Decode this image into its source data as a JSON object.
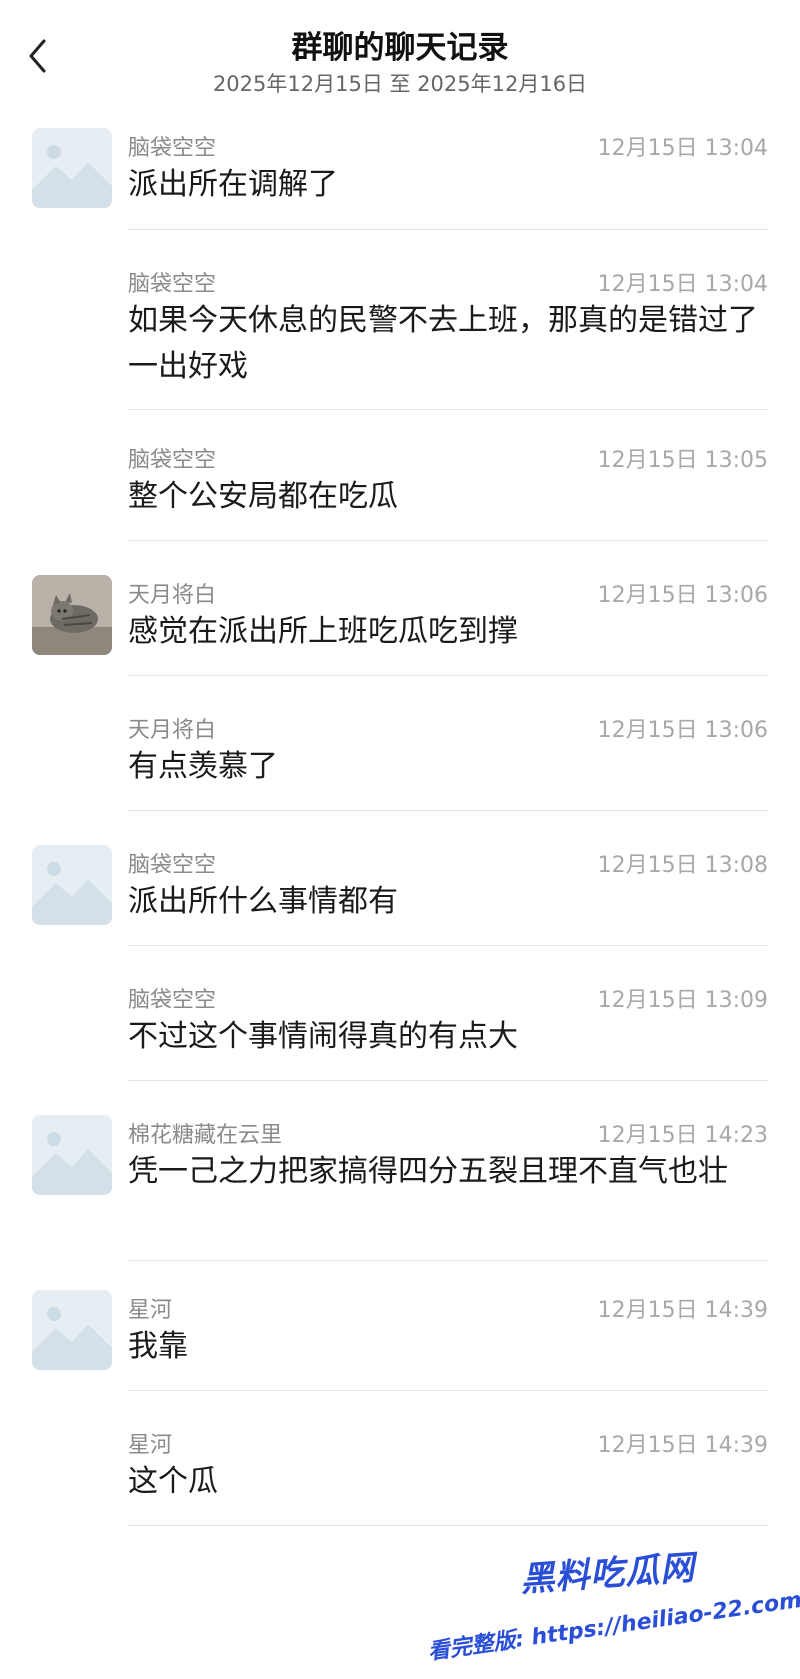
{
  "header": {
    "title": "群聊的聊天记录",
    "date_range": "2025年12月15日 至 2025年12月16日"
  },
  "messages": [
    {
      "sender": "脑袋空空",
      "time": "12月15日 13:04",
      "text": "派出所在调解了",
      "avatar": "placeholder-avatar"
    },
    {
      "sender": "脑袋空空",
      "time": "12月15日 13:04",
      "text": "如果今天休息的民警不去上班，那真的是错过了一出好戏"
    },
    {
      "sender": "脑袋空空",
      "time": "12月15日 13:05",
      "text": "整个公安局都在吃瓜"
    },
    {
      "sender": "天月将白",
      "time": "12月15日 13:06",
      "text": "感觉在派出所上班吃瓜吃到撑",
      "avatar": "cat-photo-avatar"
    },
    {
      "sender": "天月将白",
      "time": "12月15日 13:06",
      "text": "有点羡慕了"
    },
    {
      "sender": "脑袋空空",
      "time": "12月15日 13:08",
      "text": "派出所什么事情都有",
      "avatar": "placeholder-avatar"
    },
    {
      "sender": "脑袋空空",
      "time": "12月15日 13:09",
      "text": "不过这个事情闹得真的有点大"
    },
    {
      "sender": "棉花糖藏在云里",
      "time": "12月15日 14:23",
      "text": "凭一己之力把家搞得四分五裂且理不直气也壮",
      "avatar": "placeholder-avatar"
    },
    {
      "sender": "星河",
      "time": "12月15日 14:39",
      "text": "我靠",
      "avatar": "placeholder-avatar"
    },
    {
      "sender": "星河",
      "time": "12月15日 14:39",
      "text": "这个瓜"
    }
  ],
  "watermark": {
    "brand": "黑料吃瓜网",
    "line2": "看完整版: https://heiliao-22.com"
  },
  "colors": {
    "name": "#8a8a8a",
    "time": "#a8a8a8",
    "divider": "#e4e4e4",
    "watermark": "#2a4fd6"
  }
}
